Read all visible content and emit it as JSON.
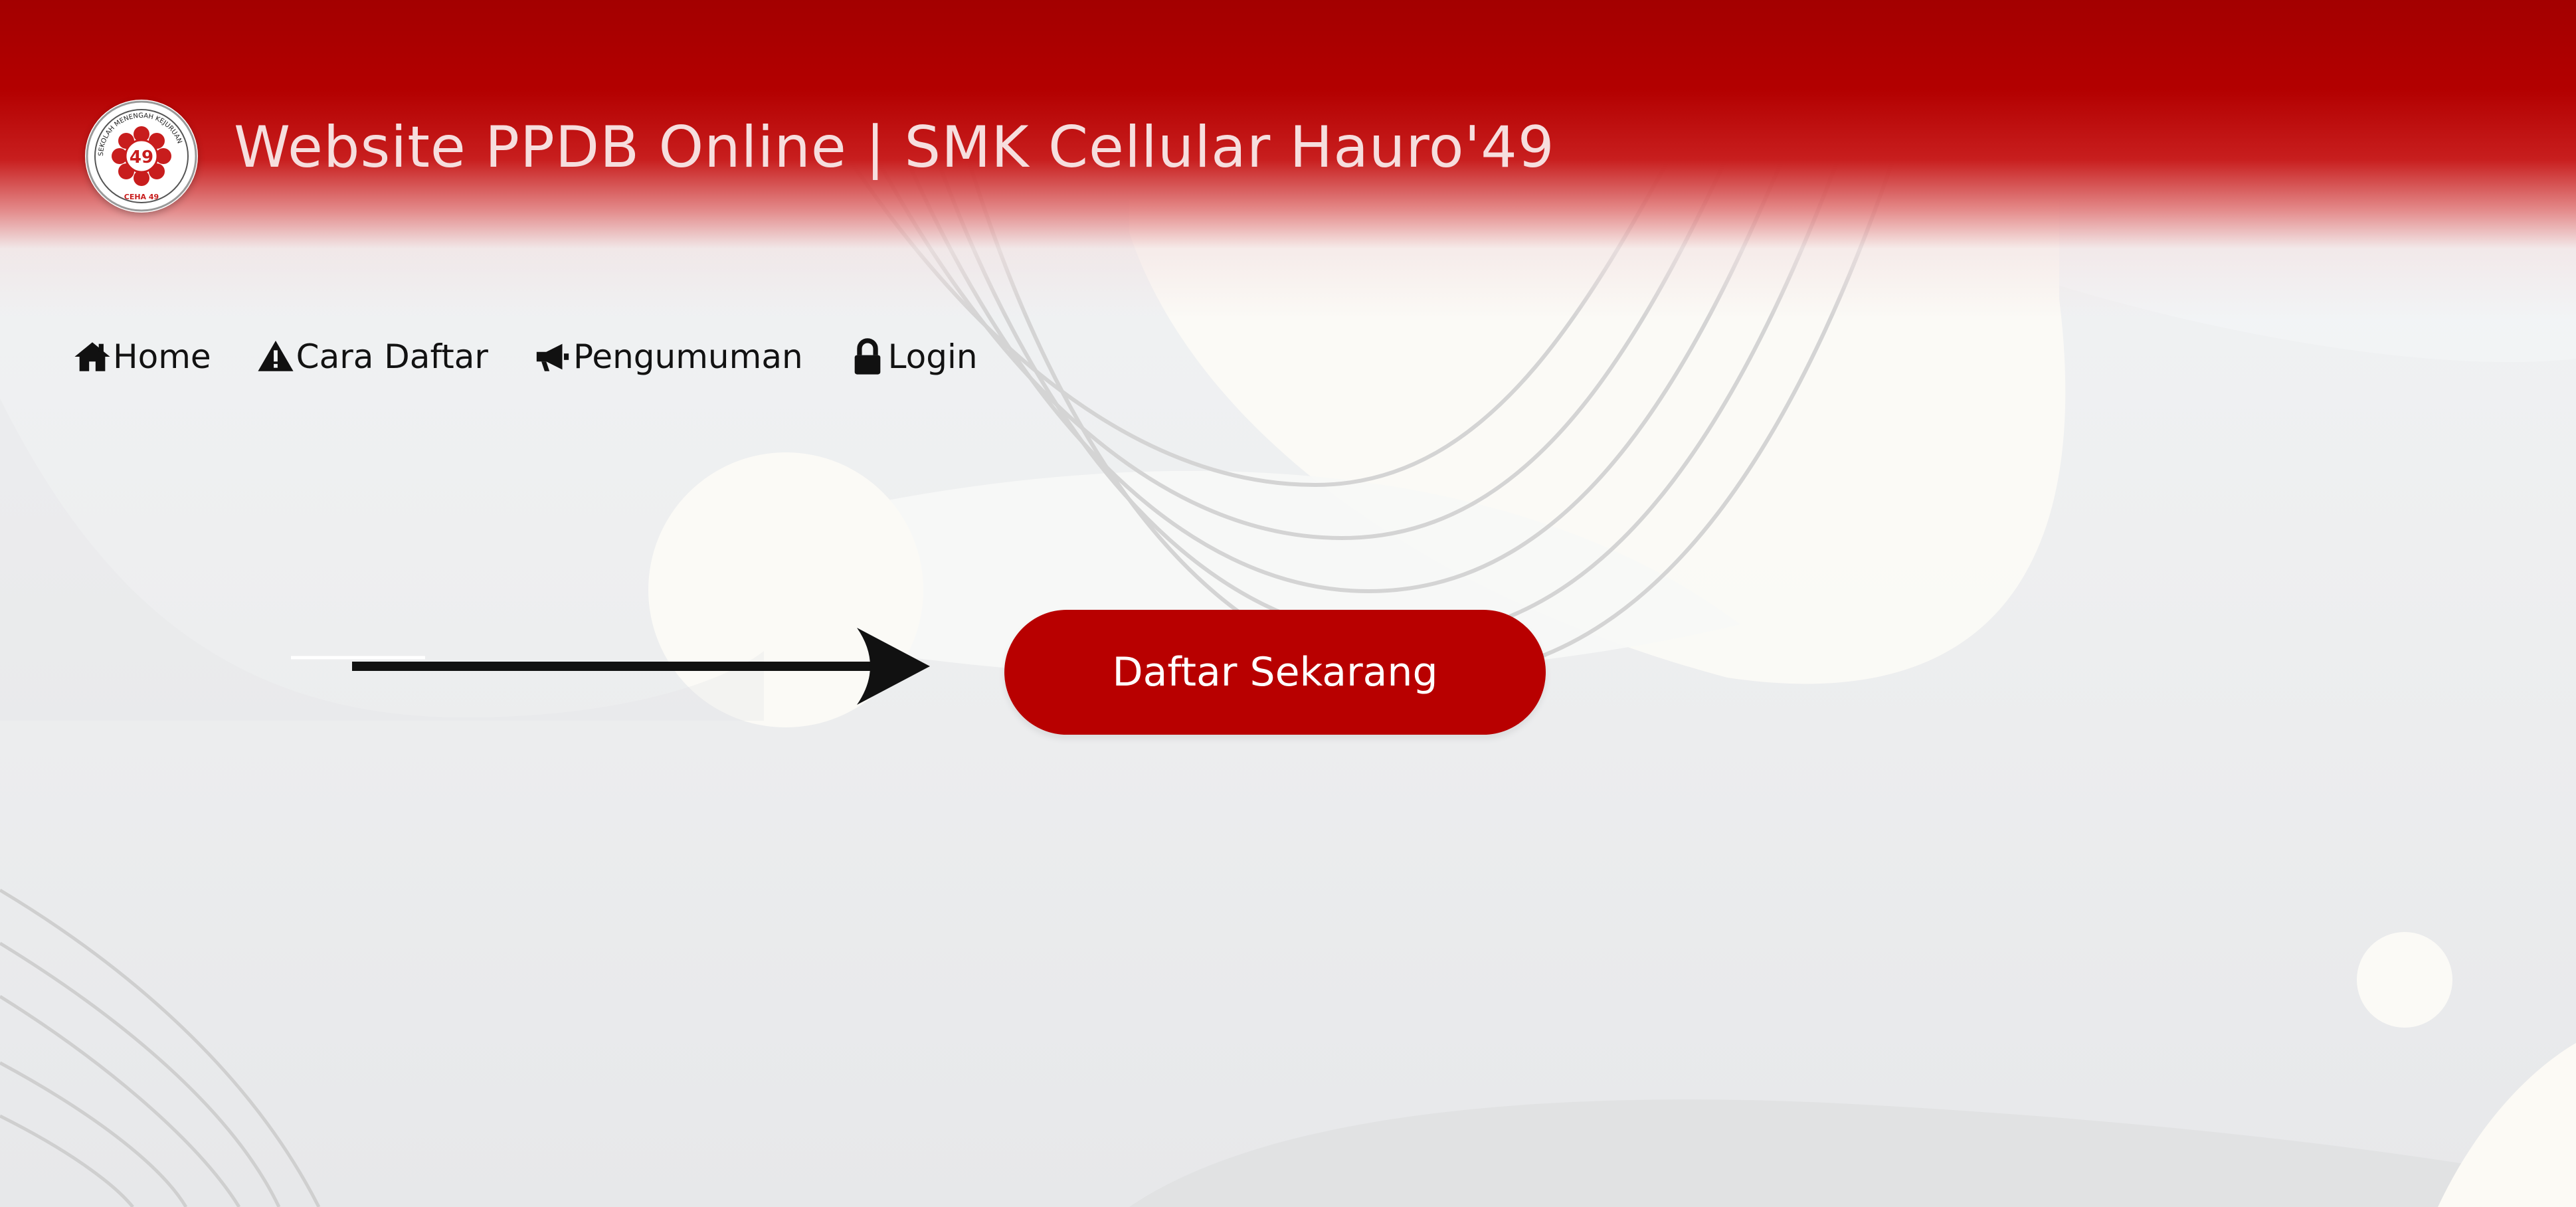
{
  "header": {
    "title": "Website PPDB Online | SMK Cellular Hauro'49",
    "logo_icon": "school-logo-icon",
    "logo_number": "49",
    "logo_ring_text": "SEKOLAH MENENGAH KEJURUAN",
    "logo_motto": "CEHA 49"
  },
  "nav": {
    "items": [
      {
        "label": "Home",
        "icon": "home-icon"
      },
      {
        "label": "Cara Daftar",
        "icon": "warning-icon"
      },
      {
        "label": "Pengumuman",
        "icon": "megaphone-icon"
      },
      {
        "label": "Login",
        "icon": "lock-icon"
      }
    ]
  },
  "hero": {
    "cta_label": "Daftar Sekarang",
    "pointer_icon": "arrow-right-icon"
  },
  "colors": {
    "brand_red": "#b80000",
    "header_red": "#a30000",
    "title_text": "#f6dede",
    "nav_text": "#121212",
    "background": "#eeeff0"
  }
}
